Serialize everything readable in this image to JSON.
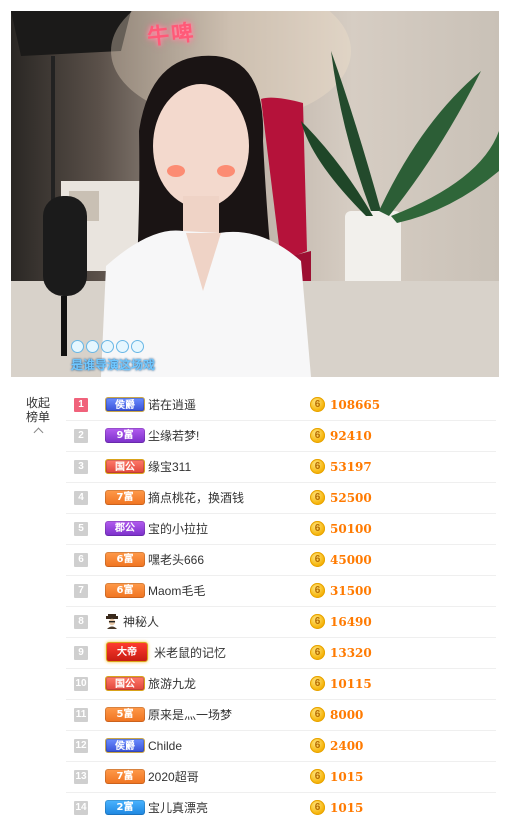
{
  "stream": {
    "neon_sign": "牛啤",
    "caption": "是谁导演这场戏"
  },
  "collapse": {
    "line1": "收起",
    "line2": "榜单"
  },
  "colors": {
    "rank_top": "#f0627b",
    "rank_default": "#cfcfcf",
    "amount": "#ff7a00",
    "coin": "#f6b60e"
  },
  "ranking": [
    {
      "rank": "1",
      "badge": "侯爵",
      "badge_style": "marquis",
      "name": "诺在逍遥",
      "amount": "108665"
    },
    {
      "rank": "2",
      "badge": "9富",
      "badge_style": "purple",
      "name": "尘缘若梦!",
      "amount": "92410"
    },
    {
      "rank": "3",
      "badge": "国公",
      "badge_style": "duke",
      "name": "缘宝311",
      "amount": "53197"
    },
    {
      "rank": "4",
      "badge": "7富",
      "badge_style": "orange",
      "name": "摘点桃花，换酒钱",
      "amount": "52500"
    },
    {
      "rank": "5",
      "badge": "郡公",
      "badge_style": "purple",
      "name": "宝的小拉拉",
      "amount": "50100"
    },
    {
      "rank": "6",
      "badge": "6富",
      "badge_style": "orange",
      "name": "嘿老头666",
      "amount": "45000"
    },
    {
      "rank": "7",
      "badge": "6富",
      "badge_style": "orange",
      "name": "Maom毛毛",
      "amount": "31500"
    },
    {
      "rank": "8",
      "badge": "",
      "badge_style": "mystery",
      "name": "神秘人",
      "amount": "16490"
    },
    {
      "rank": "9",
      "badge": "大帝",
      "badge_style": "emperor",
      "name": "米老鼠的记忆",
      "amount": "13320"
    },
    {
      "rank": "10",
      "badge": "国公",
      "badge_style": "duke",
      "name": "旅游九龙",
      "amount": "10115"
    },
    {
      "rank": "11",
      "badge": "5富",
      "badge_style": "orange",
      "name": "原来是灬一场梦",
      "amount": "8000"
    },
    {
      "rank": "12",
      "badge": "侯爵",
      "badge_style": "marquis",
      "name": "Childe",
      "amount": "2400"
    },
    {
      "rank": "13",
      "badge": "7富",
      "badge_style": "orange",
      "name": "2020超哥",
      "amount": "1015"
    },
    {
      "rank": "14",
      "badge": "2富",
      "badge_style": "blue",
      "name": "宝儿真漂亮",
      "amount": "1015"
    }
  ]
}
